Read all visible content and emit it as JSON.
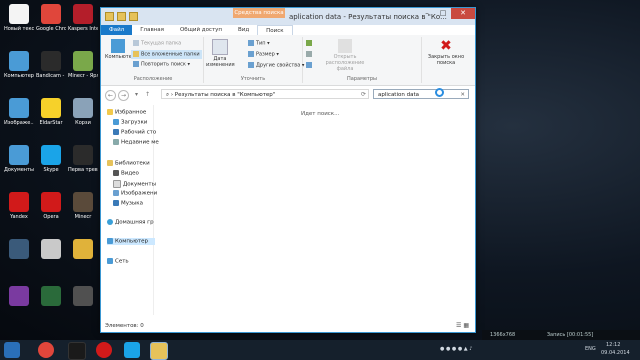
{
  "desktop": {
    "icons": [
      {
        "label": "Новый текстов...",
        "color": "#f4f4f4"
      },
      {
        "label": "Google Chrome",
        "color": "#e0463b"
      },
      {
        "label": "Kaspers Internet",
        "color": "#b41e2a"
      },
      {
        "label": "Компьютер - Ярлык",
        "color": "#4a9bd6"
      },
      {
        "label": "Bandicam - Ярлык",
        "color": "#2b2b2b"
      },
      {
        "label": "Minecr - Ярлык",
        "color": "#7aa84a"
      },
      {
        "label": "Изображе... - Ярлык",
        "color": "#4a9bd6"
      },
      {
        "label": "EldarStar",
        "color": "#f6d12a"
      },
      {
        "label": "Корзи",
        "color": "#8aa2b8"
      },
      {
        "label": "Документы - Ярлык",
        "color": "#4a9bd6"
      },
      {
        "label": "Skype",
        "color": "#1aa4e8"
      },
      {
        "label": "Перва тревог",
        "color": "#2b2b2b"
      },
      {
        "label": "Yandex",
        "color": "#d11a1a"
      },
      {
        "label": "Opera",
        "color": "#d11a1a"
      },
      {
        "label": "Minecr",
        "color": "#5a4a3a"
      },
      {
        "label": "",
        "color": "#3a5a7a"
      },
      {
        "label": "",
        "color": "#c9c9c9"
      },
      {
        "label": "",
        "color": "#e0b23a"
      },
      {
        "label": "",
        "color": "#7a3aa0"
      },
      {
        "label": "",
        "color": "#2a6a3a"
      },
      {
        "label": "",
        "color": "#505050"
      }
    ]
  },
  "window": {
    "title": "aplication data - Результаты поиска в \"Ко...",
    "context_tab": "Средства поиска",
    "tabs": [
      "Файл",
      "Главная",
      "Общий доступ",
      "Вид",
      "Поиск"
    ],
    "active_tab": "Поиск",
    "ribbon": {
      "computer_btn": "Компьютер",
      "current_folder": "Текущая папка",
      "all_subfolders": "Все вложенные папки",
      "search_again": "Повторить поиск",
      "group_location": "Расположение",
      "date_modified": "Дата изменения",
      "type": "Тип",
      "size": "Размер",
      "other_props": "Другие свойства",
      "group_refine": "Уточнить",
      "open_location": "Открыть расположение файла",
      "group_options": "Параметры",
      "close_search": "Закрыть окно поиска"
    },
    "address": "Результаты поиска в \"Компьютер\"",
    "search_value": "aplication data",
    "nav": {
      "favorites": "Избранное",
      "downloads": "Загрузки",
      "desktop": "Рабочий сто",
      "recent": "Недавние ме",
      "libraries": "Библиотеки",
      "video": "Видео",
      "documents": "Документы",
      "images": "Изображени",
      "music": "Музыка",
      "homegroup": "Домашняя гр",
      "computer": "Компьютер",
      "network": "Сеть"
    },
    "searching_text": "Идет поиск...",
    "status": "Элементов: 0"
  },
  "recorder": {
    "resolution": "1366x768",
    "recording": "Запись [00:01:55]"
  },
  "tray": {
    "lang": "ENG",
    "time": "12:12",
    "date": "09.04.2014"
  }
}
